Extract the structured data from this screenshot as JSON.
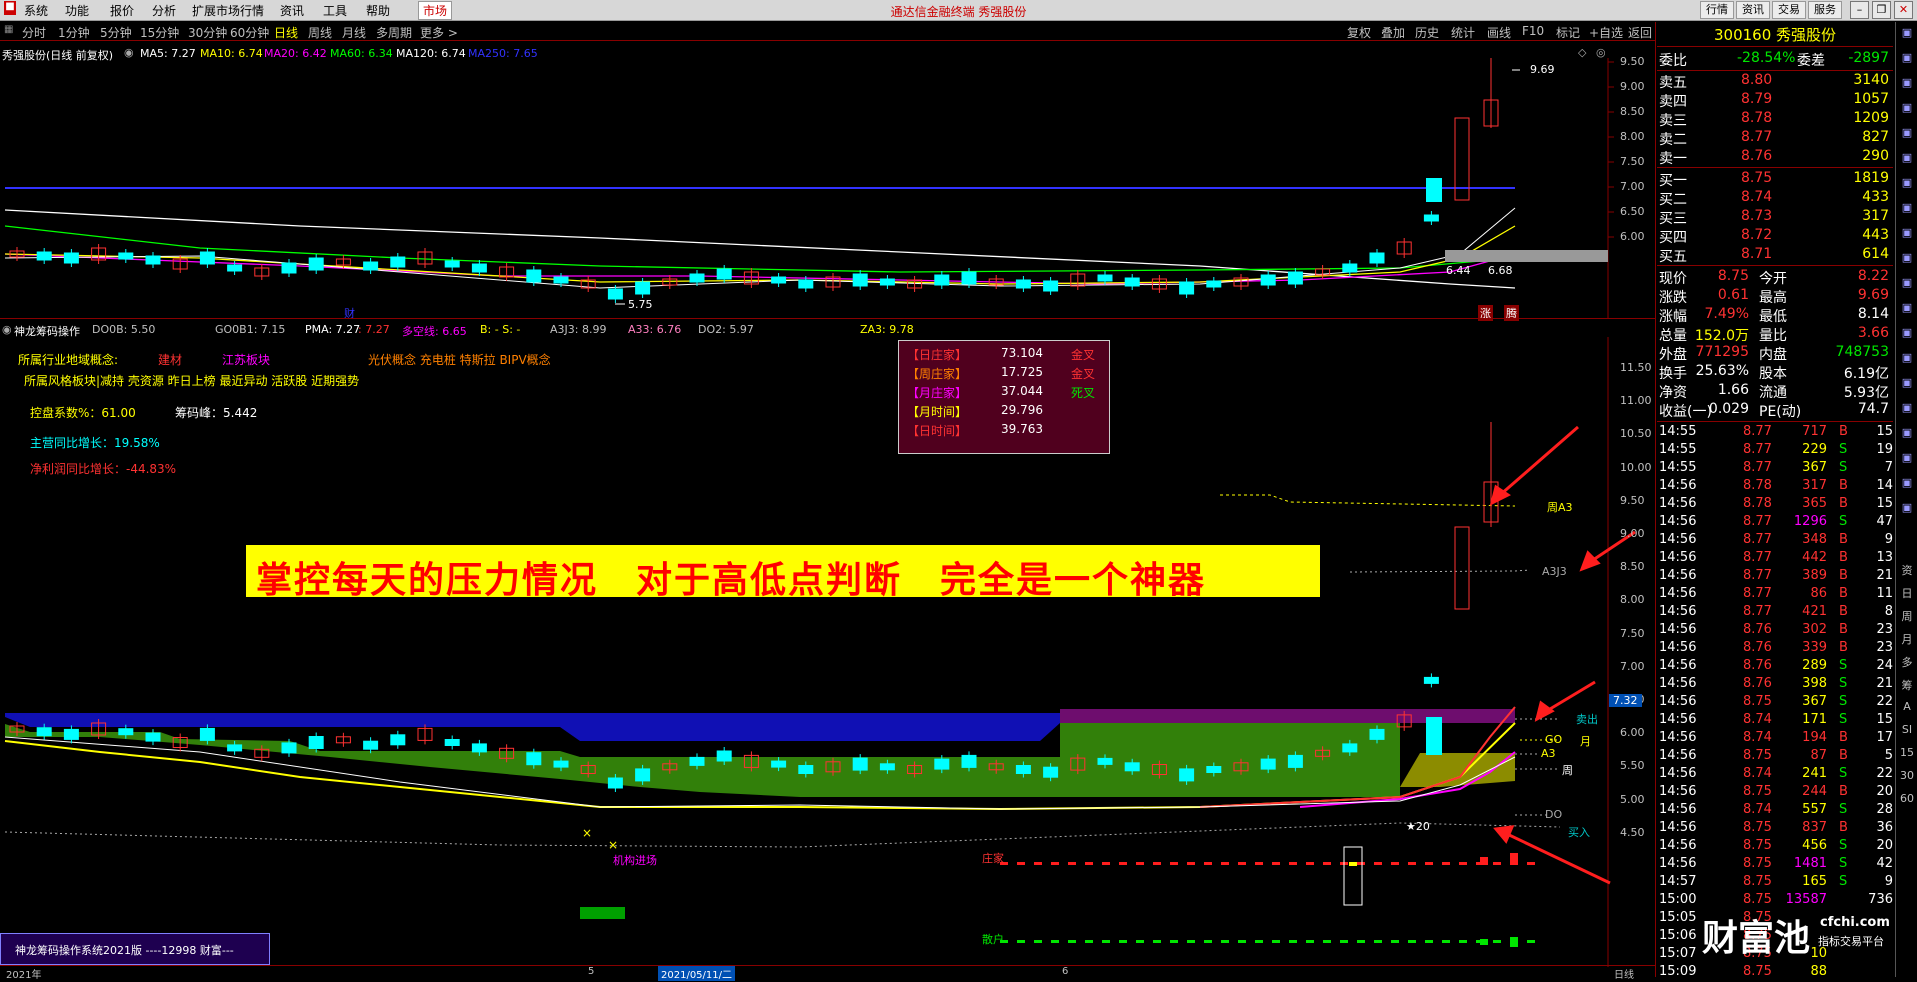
{
  "titlebar": {
    "menus": [
      "系统",
      "功能",
      "报价",
      "分析",
      "扩展市场行情",
      "资讯",
      "工具",
      "帮助"
    ],
    "active_menu": "市场",
    "title": "通达信金融终端 秀强股份",
    "right_buttons": [
      "行情",
      "资讯",
      "交易",
      "服务"
    ]
  },
  "periodbar": {
    "periods": [
      "分时",
      "1分钟",
      "5分钟",
      "15分钟",
      "30分钟",
      "60分钟",
      "日线",
      "周线",
      "月线",
      "多周期",
      "更多 >"
    ],
    "selected": "日线",
    "tools": [
      "复权",
      "叠加",
      "历史",
      "统计",
      "画线",
      "F10",
      "标记",
      "+自选",
      "返回"
    ]
  },
  "main_chart": {
    "name": "秀强股份(日线 前复权)",
    "ma": [
      {
        "label": "MA5: 7.27",
        "color": "#ffffff"
      },
      {
        "label": "MA10: 6.74",
        "color": "#ffff00"
      },
      {
        "label": "MA20: 6.42",
        "color": "#ff00ff"
      },
      {
        "label": "MA60: 6.34",
        "color": "#00ff00"
      },
      {
        "label": "MA120: 6.74",
        "color": "#ffffff"
      },
      {
        "label": "MA250: 7.65",
        "color": "#3232ff"
      }
    ],
    "yaxis": [
      "9.50",
      "9.00",
      "8.50",
      "8.00",
      "7.50",
      "7.00",
      "6.50",
      "6.00"
    ],
    "high_label": "9.69",
    "low_label": "5.75",
    "mark_labels": [
      "6.44",
      "6.68"
    ],
    "cai_label": "财",
    "up_labels": [
      "涨",
      "腾"
    ]
  },
  "indicator": {
    "name": "神龙筹码操作",
    "values": [
      {
        "label": "DO0B: 5.50",
        "color": "#c0c0c0"
      },
      {
        "label": "GO0B1: 7.15",
        "color": "#c0c0c0"
      },
      {
        "label": "PMA: 7.27",
        "color": "#ffffff"
      },
      {
        "label": ": 7.27",
        "color": "#ff3232"
      },
      {
        "label": "多空线: 6.65",
        "color": "#ff00ff"
      },
      {
        "label": "B: -  S: -",
        "color": "#ffff00"
      },
      {
        "label": "A3J3: 8.99",
        "color": "#c0c0c0"
      },
      {
        "label": "A33: 6.76",
        "color": "#ff80c0"
      },
      {
        "label": "DO2: 5.97",
        "color": "#c0c0c0"
      },
      {
        "label": "ZA3: 9.78",
        "color": "#ffff00"
      }
    ],
    "yaxis": [
      "11.50",
      "11.00",
      "10.50",
      "10.00",
      "9.50",
      "9.00",
      "8.50",
      "8.00",
      "7.50",
      "7.00",
      "6.50",
      "6.00",
      "5.50",
      "5.00",
      "4.50"
    ],
    "price_tag": "7.32",
    "concept_label": "所属行业地域概念:",
    "concept_items": [
      {
        "t": "建材",
        "c": "#ff3232"
      },
      {
        "t": "江苏板块",
        "c": "#ff00ff"
      },
      {
        "t": "光伏概念 充电桩 特斯拉 BIPV概念",
        "c": "#ff8000"
      }
    ],
    "style_line": "所属风格板块|减持 壳资源 昨日上榜 最近异动 活跃股 近期强势",
    "control_label": "控盘系数%：61.00",
    "chip_label": "筹码峰：5.442",
    "revenue_growth": "主营同比增长：19.58%",
    "profit_growth": "净利润同比增长：-44.83%",
    "banner": "掌控每天的压力情况　对于高低点判断　完全是一个神器",
    "box_rows": [
      {
        "k": "【日庄家】",
        "v": "73.104",
        "s": "金叉",
        "kc": "#ff3232",
        "sc": "#ff3232"
      },
      {
        "k": "【周庄家】",
        "v": "17.725",
        "s": "金叉",
        "kc": "#ff8000",
        "sc": "#ff3232"
      },
      {
        "k": "【月庄家】",
        "v": "37.044",
        "s": "死叉",
        "kc": "#ff00ff",
        "sc": "#00e600"
      },
      {
        "k": "【月时间】",
        "v": "29.796",
        "s": "",
        "kc": "#ffff00",
        "sc": "#ffffff"
      },
      {
        "k": "【日时间】",
        "v": "39.763",
        "s": "",
        "kc": "#ff3232",
        "sc": "#ffffff"
      }
    ],
    "labels": {
      "zhou_a3": "周A3",
      "a3j3": "A3J3",
      "sell": "卖出",
      "go": "GO",
      "month": "月",
      "a3": "A3",
      "week": "周",
      "do": "DO",
      "buy": "买入",
      "star": "★20",
      "institution": "机构进场",
      "zhuangjia": "庄家",
      "sanhu": "散户"
    },
    "system_label": "神龙筹码操作系统2021版 ----12998 财富---"
  },
  "xaxis": {
    "left": "2021年",
    "mid1": "5",
    "date": "2021/05/11/二",
    "mid2": "6",
    "right": "日线"
  },
  "quote": {
    "code_name": "300160 秀强股份",
    "ratio": {
      "label": "委比",
      "value": "-28.54%",
      "label2": "委差",
      "value2": "-2897"
    },
    "asks": [
      {
        "label": "卖五",
        "price": "8.80",
        "vol": "3140"
      },
      {
        "label": "卖四",
        "price": "8.79",
        "vol": "1057"
      },
      {
        "label": "卖三",
        "price": "8.78",
        "vol": "1209"
      },
      {
        "label": "卖二",
        "price": "8.77",
        "vol": "827"
      },
      {
        "label": "卖一",
        "price": "8.76",
        "vol": "290"
      }
    ],
    "bids": [
      {
        "label": "买一",
        "price": "8.75",
        "vol": "1819"
      },
      {
        "label": "买二",
        "price": "8.74",
        "vol": "433"
      },
      {
        "label": "买三",
        "price": "8.73",
        "vol": "317"
      },
      {
        "label": "买四",
        "price": "8.72",
        "vol": "443"
      },
      {
        "label": "买五",
        "price": "8.71",
        "vol": "614"
      }
    ],
    "stats": [
      {
        "l1": "现价",
        "v1": "8.75",
        "c1": "#ff3232",
        "l2": "今开",
        "v2": "8.22",
        "c2": "#ff3232"
      },
      {
        "l1": "涨跌",
        "v1": "0.61",
        "c1": "#ff3232",
        "l2": "最高",
        "v2": "9.69",
        "c2": "#ff3232"
      },
      {
        "l1": "涨幅",
        "v1": "7.49%",
        "c1": "#ff3232",
        "l2": "最低",
        "v2": "8.14",
        "c2": "#ffffff"
      },
      {
        "l1": "总量",
        "v1": "152.0万",
        "c1": "#ffff00",
        "l2": "量比",
        "v2": "3.66",
        "c2": "#ff3232"
      },
      {
        "l1": "外盘",
        "v1": "771295",
        "c1": "#ff3232",
        "l2": "内盘",
        "v2": "748753",
        "c2": "#00e600"
      },
      {
        "l1": "换手",
        "v1": "25.63%",
        "c1": "#ffffff",
        "l2": "股本",
        "v2": "6.19亿",
        "c2": "#ffffff"
      },
      {
        "l1": "净资",
        "v1": "1.66",
        "c1": "#ffffff",
        "l2": "流通",
        "v2": "5.93亿",
        "c2": "#ffffff"
      },
      {
        "l1": "收益(一)",
        "v1": "0.029",
        "c1": "#ffffff",
        "l2": "PE(动)",
        "v2": "74.7",
        "c2": "#ffffff"
      }
    ],
    "ticks": [
      [
        "14:55",
        "8.77",
        "717",
        "B",
        "15"
      ],
      [
        "14:55",
        "8.77",
        "229",
        "S",
        "19"
      ],
      [
        "14:55",
        "8.77",
        "367",
        "S",
        "7"
      ],
      [
        "14:56",
        "8.78",
        "317",
        "B",
        "14"
      ],
      [
        "14:56",
        "8.78",
        "365",
        "B",
        "15"
      ],
      [
        "14:56",
        "8.77",
        "1296",
        "S",
        "47"
      ],
      [
        "14:56",
        "8.77",
        "348",
        "B",
        "9"
      ],
      [
        "14:56",
        "8.77",
        "442",
        "B",
        "13"
      ],
      [
        "14:56",
        "8.77",
        "389",
        "B",
        "21"
      ],
      [
        "14:56",
        "8.77",
        "86",
        "B",
        "11"
      ],
      [
        "14:56",
        "8.77",
        "421",
        "B",
        "8"
      ],
      [
        "14:56",
        "8.76",
        "302",
        "B",
        "23"
      ],
      [
        "14:56",
        "8.76",
        "339",
        "B",
        "23"
      ],
      [
        "14:56",
        "8.76",
        "289",
        "S",
        "24"
      ],
      [
        "14:56",
        "8.76",
        "398",
        "S",
        "21"
      ],
      [
        "14:56",
        "8.75",
        "367",
        "S",
        "22"
      ],
      [
        "14:56",
        "8.74",
        "171",
        "S",
        "15"
      ],
      [
        "14:56",
        "8.74",
        "194",
        "B",
        "17"
      ],
      [
        "14:56",
        "8.75",
        "87",
        "B",
        "5"
      ],
      [
        "14:56",
        "8.74",
        "241",
        "S",
        "22"
      ],
      [
        "14:56",
        "8.75",
        "244",
        "B",
        "20"
      ],
      [
        "14:56",
        "8.74",
        "557",
        "S",
        "28"
      ],
      [
        "14:56",
        "8.75",
        "837",
        "B",
        "36"
      ],
      [
        "14:56",
        "8.75",
        "456",
        "S",
        "20"
      ],
      [
        "14:56",
        "8.75",
        "1481",
        "S",
        "42"
      ],
      [
        "14:57",
        "8.75",
        "165",
        "S",
        "9"
      ],
      [
        "15:00",
        "8.75",
        "13587",
        "",
        "736"
      ],
      [
        "15:05",
        "8.75",
        "",
        "",
        ""
      ],
      [
        "15:06",
        "8.75",
        "",
        "",
        ""
      ],
      [
        "15:07",
        "8.75",
        "10",
        "",
        ""
      ],
      [
        "15:09",
        "8.75",
        "88",
        "",
        ""
      ]
    ],
    "watermark": "财富池",
    "watermark_site": "cfchi.com",
    "watermark_sub": "指标交易平台"
  },
  "sidebar": [
    "资",
    "日",
    "周",
    "月",
    "多",
    "筹",
    "A",
    "SI",
    "15",
    "30",
    "60"
  ],
  "colors": {
    "up": "#ff3232",
    "down": "#00ffff",
    "bg": "#000000",
    "grid": "#800000",
    "banner_bg": "#ffff00",
    "banner_fg": "#ff0000"
  }
}
